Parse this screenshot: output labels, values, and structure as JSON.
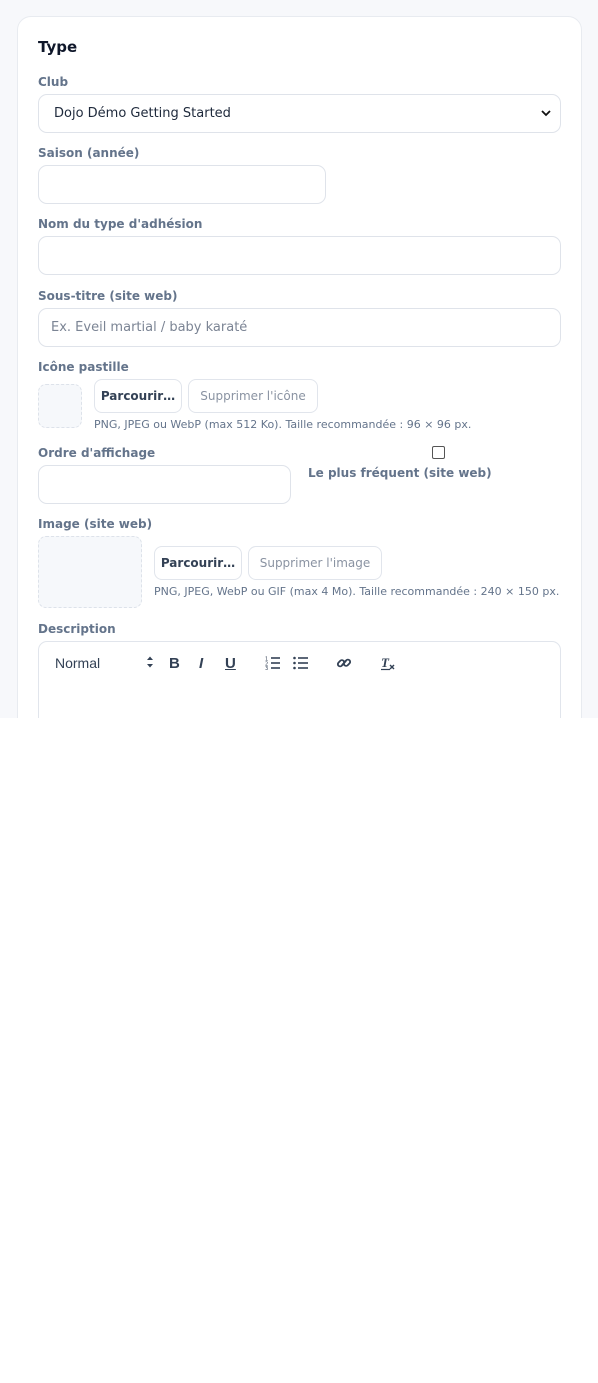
{
  "card": {
    "title": "Type"
  },
  "club": {
    "label": "Club",
    "selected": "Dojo Démo Getting Started"
  },
  "season": {
    "label": "Saison (année)",
    "value": ""
  },
  "membership_name": {
    "label": "Nom du type d'adhésion",
    "value": ""
  },
  "subtitle": {
    "label": "Sous-titre (site web)",
    "placeholder": "Ex. Éveil martial / baby karaté"
  },
  "icon": {
    "label": "Icône pastille",
    "browse_label": "Parcourir…",
    "remove_label": "Supprimer l'icône",
    "hint": "PNG, JPEG ou WebP (max 512 Ko). Taille recommandée : 96 × 96 px."
  },
  "display_order": {
    "label": "Ordre d'affichage",
    "value": ""
  },
  "most_frequent": {
    "label": "Le plus fréquent (site web)",
    "checked": false
  },
  "image": {
    "label": "Image (site web)",
    "browse_label": "Parcourir…",
    "remove_label": "Supprimer l'image",
    "hint": "PNG, JPEG, WebP ou GIF (max 4 Mo). Taille recommandée : 240 × 150 px."
  },
  "description": {
    "label": "Description",
    "format_selected": "Normal",
    "toolbar_icons": [
      "bold-icon",
      "italic-icon",
      "underline-icon",
      "ordered-list-icon",
      "bullet-list-icon",
      "link-icon",
      "clear-format-icon"
    ],
    "bold_glyph": "B",
    "italic_glyph": "I",
    "underline_glyph": "U"
  }
}
